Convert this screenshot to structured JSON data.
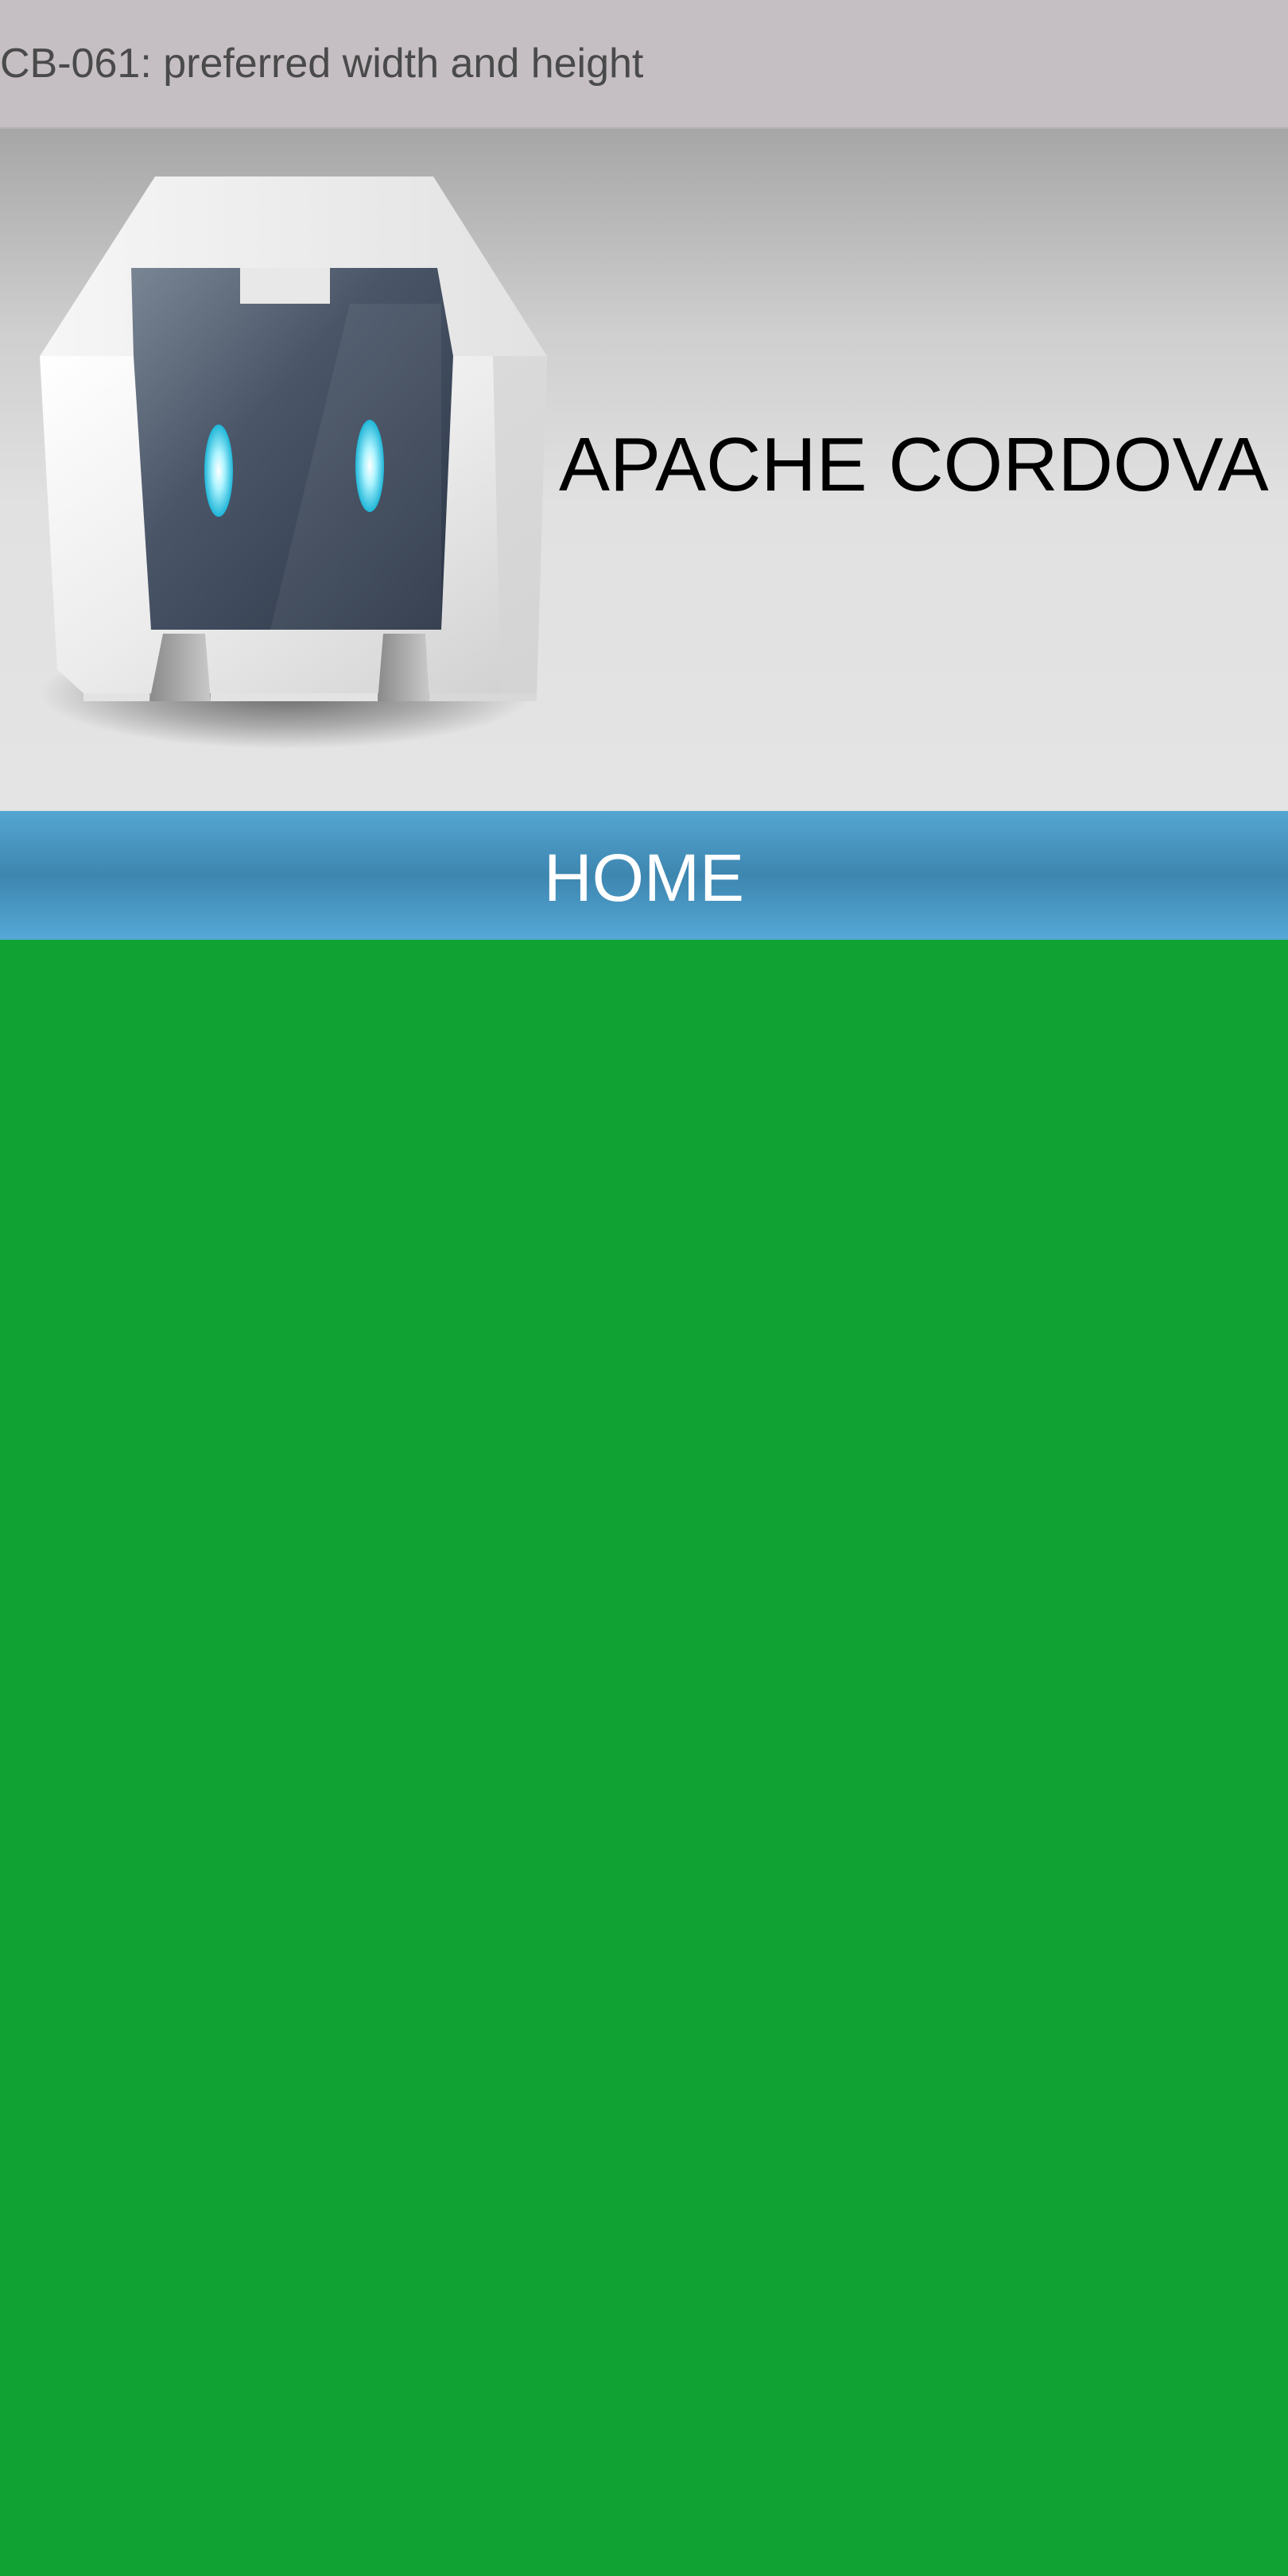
{
  "titlebar": {
    "title": "CB-061: preferred width and height"
  },
  "banner": {
    "logo_icon": "apache-cordova-robot-icon",
    "title": "APACHE CORDOVA"
  },
  "navbar": {
    "label": "HOME"
  },
  "colors": {
    "titlebar_bg": "#c5bfc3",
    "navbar_blue": "#3d86b0",
    "content_green": "#10a232"
  }
}
